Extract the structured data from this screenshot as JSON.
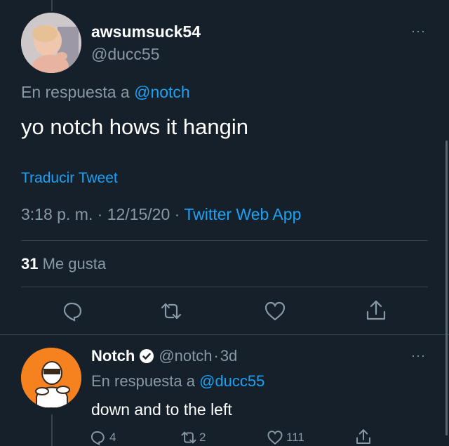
{
  "main_tweet": {
    "display_name": "awsumsuck54",
    "handle": "@ducc55",
    "reply_prefix": "En respuesta a",
    "reply_to": "@notch",
    "text": "yo notch hows it hangin",
    "translate": "Traducir Tweet",
    "time": "3:18 p. m.",
    "sep1": "·",
    "date": "12/15/20",
    "sep2": "·",
    "source": "Twitter Web App",
    "likes_count": "31",
    "likes_label": "Me gusta",
    "more": "···",
    "actions": [
      "reply-icon",
      "retweet-icon",
      "like-icon",
      "share-icon"
    ]
  },
  "reply": {
    "display_name": "Notch",
    "handle": "@notch",
    "sep": "·",
    "age": "3d",
    "reply_prefix": "En respuesta a",
    "reply_to": "@ducc55",
    "text": "down and to the left",
    "reply_count": "4",
    "retweet_count": "2",
    "like_count": "111",
    "more": "···"
  },
  "colors": {
    "background": "#15202b",
    "accent": "#1da1f2",
    "muted": "#8899a6",
    "divider": "#38444d",
    "notch_avatar_bg": "#f5821f"
  }
}
